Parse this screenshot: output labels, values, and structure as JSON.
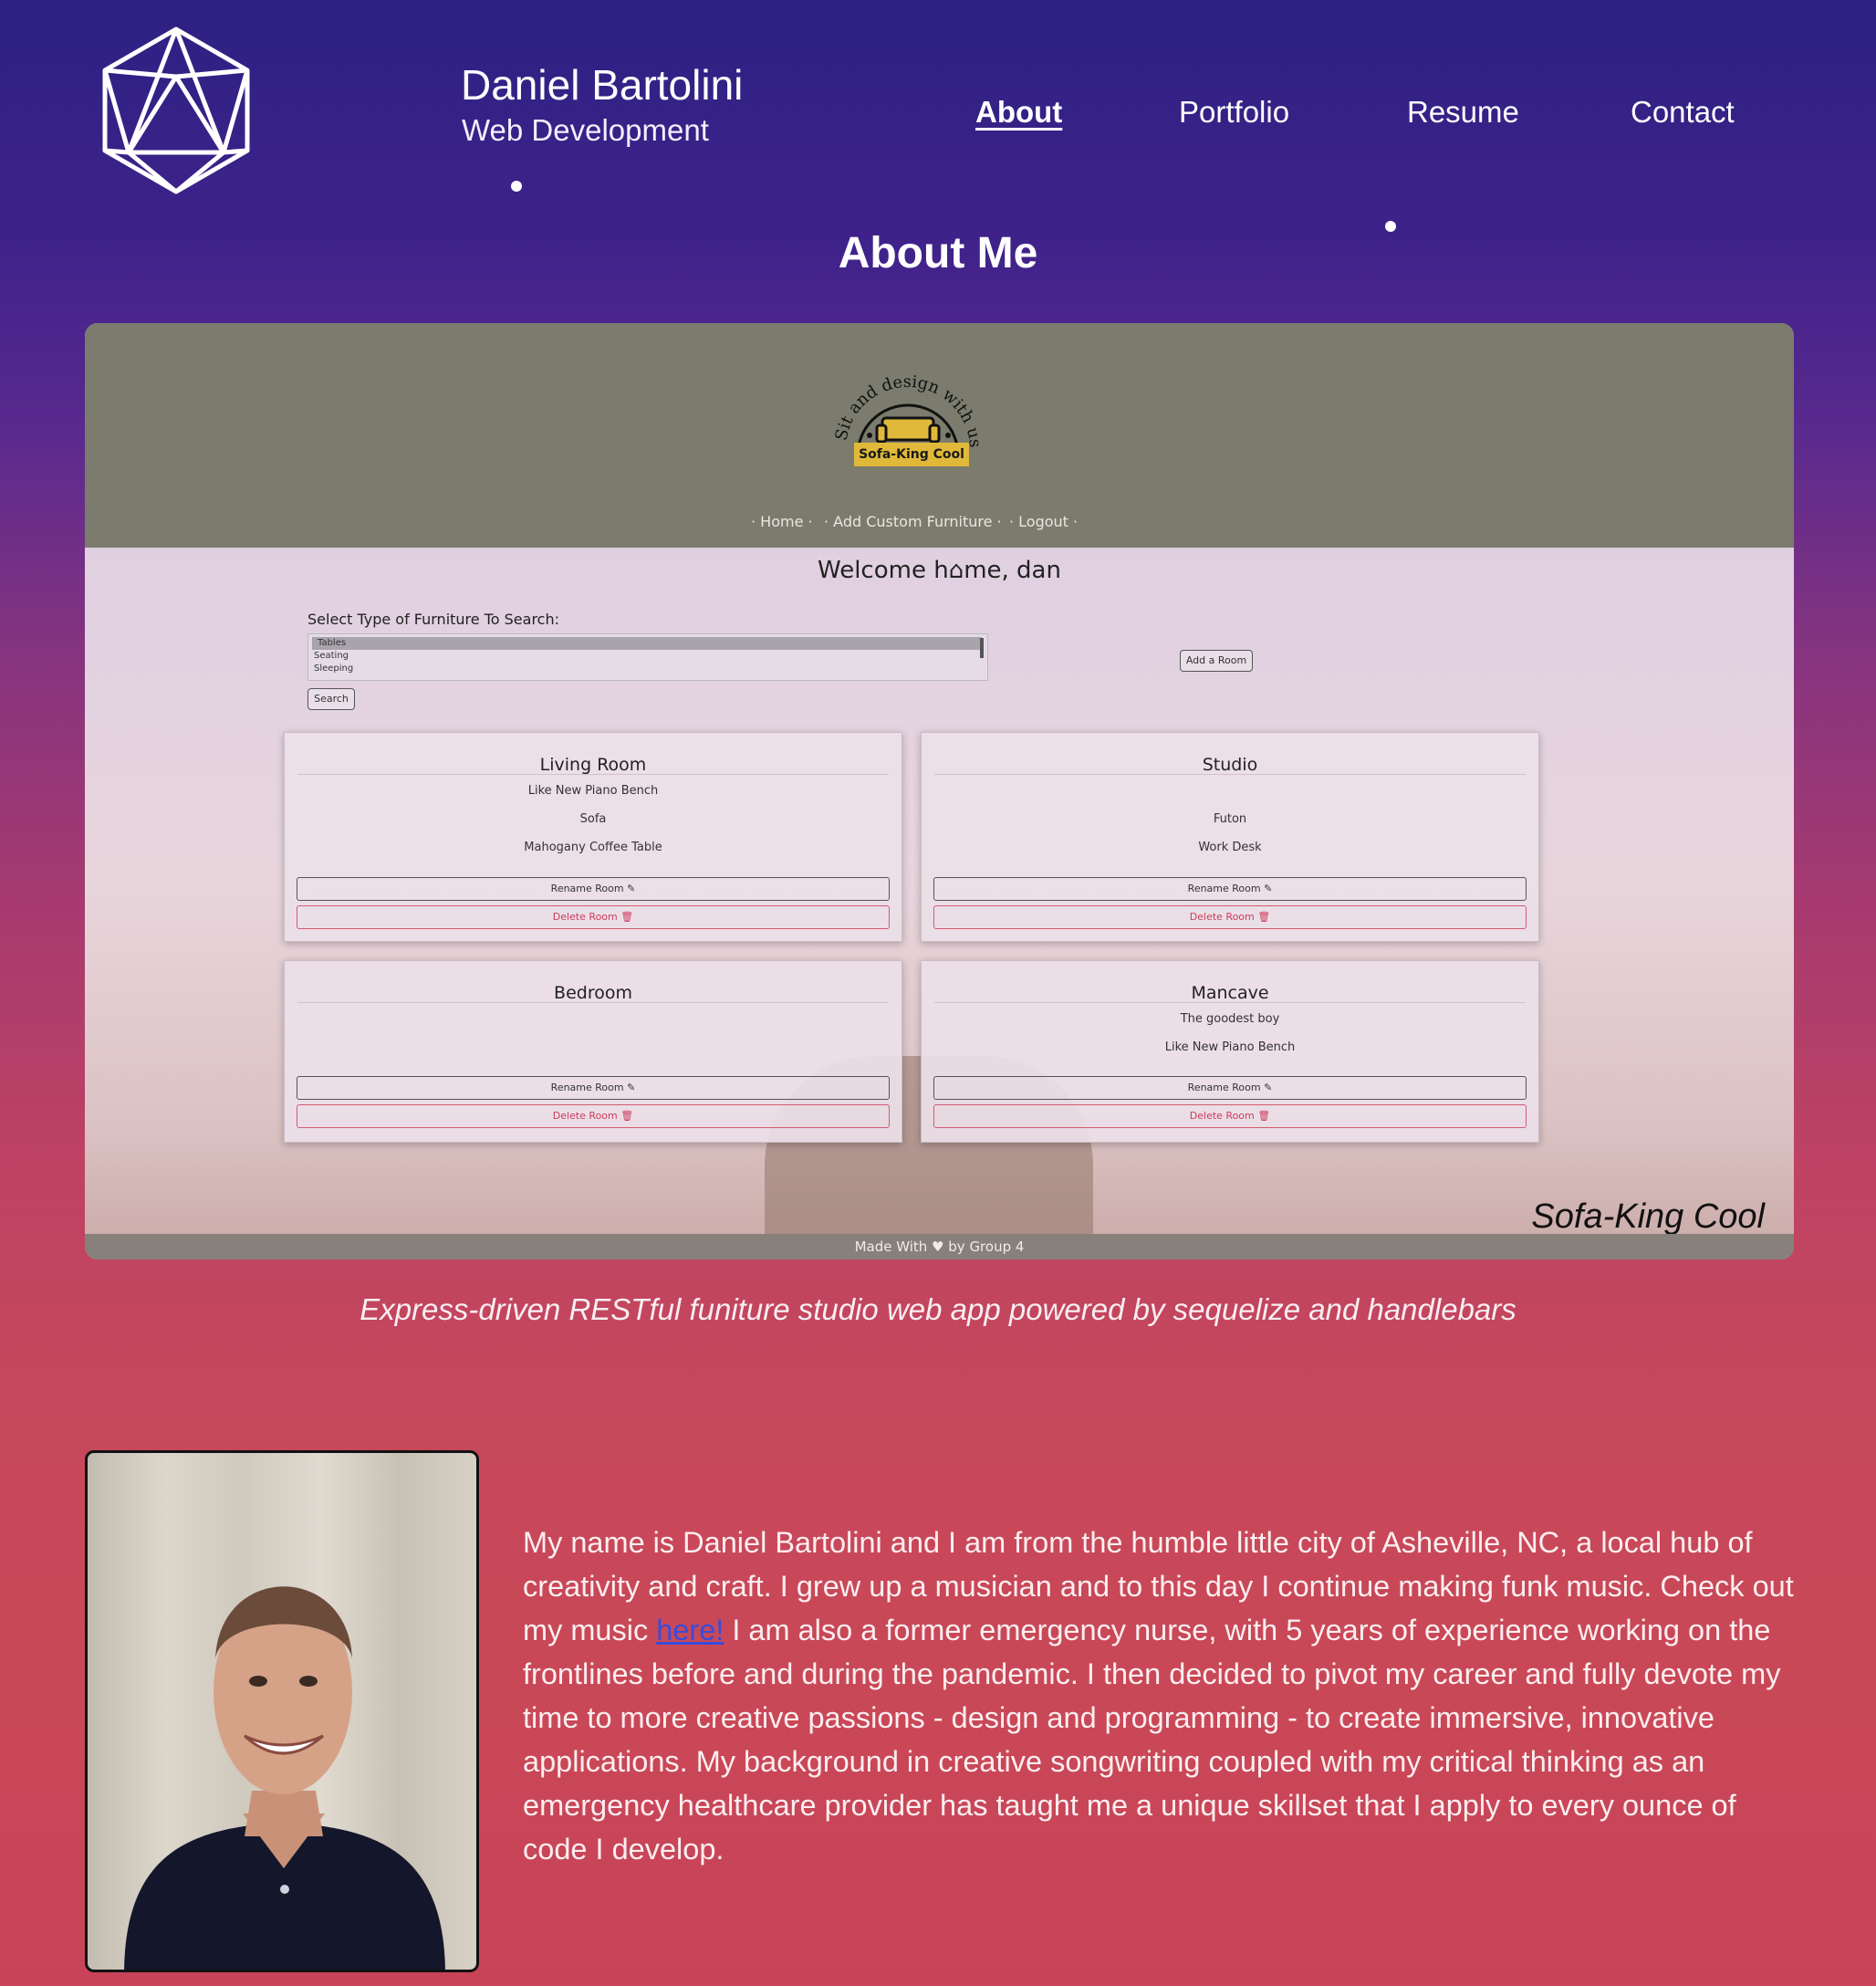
{
  "header": {
    "name": "Daniel Bartolini",
    "subtitle": "Web Development",
    "logo_icon": "d20-icosahedron-icon"
  },
  "nav": {
    "items": [
      {
        "label": "About",
        "active": true
      },
      {
        "label": "Portfolio",
        "active": false
      },
      {
        "label": "Resume",
        "active": false
      },
      {
        "label": "Contact",
        "active": false
      }
    ]
  },
  "page_title": "About Me",
  "showcase": {
    "logo_arc_text": "Sit and design with us!",
    "logo_badge": "Sofa-King Cool",
    "nav": [
      "· Home ·",
      "· Add Custom Furniture ·",
      "· Logout ·"
    ],
    "welcome": "Welcome h⌂me, dan",
    "search_label": "Select Type of Furniture To Search:",
    "options": [
      "Tables",
      "Seating",
      "Sleeping"
    ],
    "search_button": "Search",
    "add_room_button": "Add a Room",
    "rooms": [
      {
        "name": "Living Room",
        "items": [
          "Like New Piano Bench",
          "Sofa",
          "Mahogany Coffee Table"
        ]
      },
      {
        "name": "Studio",
        "items": [
          "Futon",
          "Work Desk"
        ]
      },
      {
        "name": "Bedroom",
        "items": []
      },
      {
        "name": "Mancave",
        "items": [
          "The goodest boy",
          "Like New Piano Bench"
        ]
      }
    ],
    "rename_label": "Rename Room ✎",
    "delete_label": "Delete Room 🗑",
    "brand": "Sofa-King Cool",
    "footer": "Made With ♥ by Group 4"
  },
  "caption": "Express-driven RESTful funiture studio web app powered by sequelize and handlebars",
  "bio": {
    "part1": "My name is Daniel Bartolini and I am from the humble little city of Asheville, NC, a local hub of creativity and craft. I grew up a musician and to this day I continue making funk music. Check out my music ",
    "link": "here!",
    "part2": " I am also a former emergency nurse, with 5 years of experience working on the frontlines before and during the pandemic. I then decided to pivot my career and fully devote my time to more creative passions - design and programming - to create immersive, innovative applications. My background in creative songwriting coupled with my critical thinking as an emergency healthcare provider has taught me a unique skillset that I apply to every ounce of code I develop."
  }
}
